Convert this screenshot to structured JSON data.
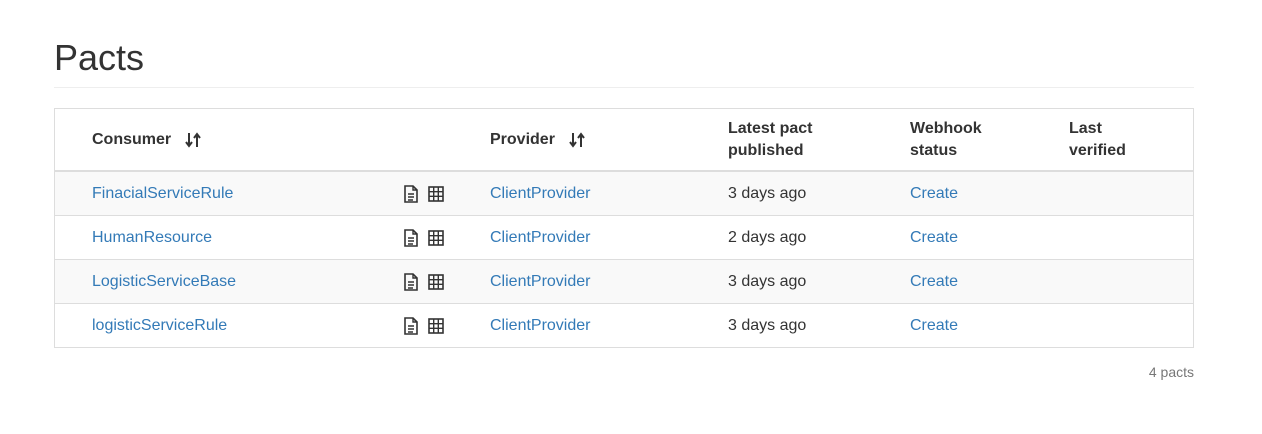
{
  "page": {
    "title": "Pacts"
  },
  "table": {
    "headers": {
      "consumer": "Consumer",
      "provider": "Provider",
      "latest_line1": "Latest pact",
      "latest_line2": "published",
      "webhook_line1": "Webhook",
      "webhook_line2": "status",
      "verified_line1": "Last",
      "verified_line2": "verified"
    },
    "icons": {
      "sort": "sort-arrows-icon",
      "document": "document-icon",
      "matrix": "table-grid-icon"
    },
    "rows": [
      {
        "consumer": "FinacialServiceRule",
        "provider": "ClientProvider",
        "published": "3 days ago",
        "webhook": "Create",
        "verified": ""
      },
      {
        "consumer": "HumanResource",
        "provider": "ClientProvider",
        "published": "2 days ago",
        "webhook": "Create",
        "verified": ""
      },
      {
        "consumer": "LogisticServiceBase",
        "provider": "ClientProvider",
        "published": "3 days ago",
        "webhook": "Create",
        "verified": ""
      },
      {
        "consumer": "logisticServiceRule",
        "provider": "ClientProvider",
        "published": "3 days ago",
        "webhook": "Create",
        "verified": ""
      }
    ]
  },
  "footer": {
    "count": "4 pacts"
  }
}
